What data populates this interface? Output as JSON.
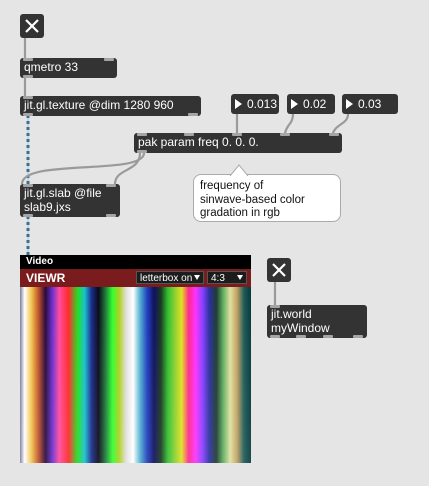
{
  "objects": {
    "metro": "qmetro 33",
    "texture": "jit.gl.texture @dim 1280 960",
    "pak": "pak param freq 0. 0. 0.",
    "slab": "jit.gl.slab @file\nslab9.jxs",
    "world": "jit.world\nmyWindow"
  },
  "numbers": {
    "n1": "0.013",
    "n2": "0.02",
    "n3": "0.03"
  },
  "comment": "frequency of\nsinwave-based color\ngradation in rgb",
  "viewer": {
    "title": "Video",
    "name": "VIEWR",
    "mode_option": "letterbox on",
    "aspect_option": "4:3"
  },
  "colors": {
    "object_bg": "#333333",
    "patchcord_signal": "#7aa6c2",
    "viewer_bar": "#7a1b1d"
  },
  "icons": {
    "toggle": "x-icon"
  }
}
